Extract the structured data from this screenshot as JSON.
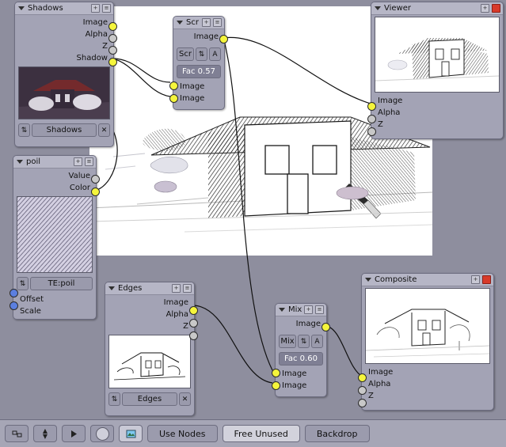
{
  "app": {
    "editor": "node-editor"
  },
  "nodes": {
    "shadows": {
      "title": "Shadows",
      "outputs": [
        "Image",
        "Alpha",
        "Z",
        "Shadow"
      ],
      "menu_label": "Shadows"
    },
    "scr": {
      "title": "Scr",
      "outputs": [
        "Image"
      ],
      "blend_mode": "Scr",
      "alpha_label": "A",
      "fac_label": "Fac 0.57",
      "inputs": [
        "Image",
        "Image"
      ]
    },
    "viewer": {
      "title": "Viewer",
      "inputs": [
        "Image",
        "Alpha",
        "Z"
      ]
    },
    "poil": {
      "title": "poil",
      "outputs": [
        "Value",
        "Color"
      ],
      "texture_label": "TE:poil",
      "params": [
        "Offset",
        "Scale"
      ]
    },
    "edges": {
      "title": "Edges",
      "outputs": [
        "Image",
        "Alpha",
        "Z"
      ],
      "menu_label": "Edges"
    },
    "mix": {
      "title": "Mix",
      "outputs": [
        "Image"
      ],
      "blend_mode": "Mix",
      "alpha_label": "A",
      "fac_label": "Fac 0.60",
      "inputs": [
        "Image",
        "Image"
      ]
    },
    "composite": {
      "title": "Composite",
      "inputs": [
        "Image",
        "Alpha",
        "Z"
      ]
    }
  },
  "footer": {
    "use_nodes": "Use Nodes",
    "free_unused": "Free Unused",
    "backdrop": "Backdrop",
    "icons": [
      "node-editor-icon",
      "dropdown-arrow-icon",
      "play-icon",
      "render-icon",
      "image-icon"
    ]
  },
  "colors": {
    "socket_image": "#f5f53c",
    "socket_value": "#c8c8c8",
    "socket_param": "#5b7fe0",
    "node_bg": "#a3a3b5",
    "header_bg": "#b6b6c6",
    "background": "#8e8e9e",
    "close_red": "#d83a2a"
  }
}
